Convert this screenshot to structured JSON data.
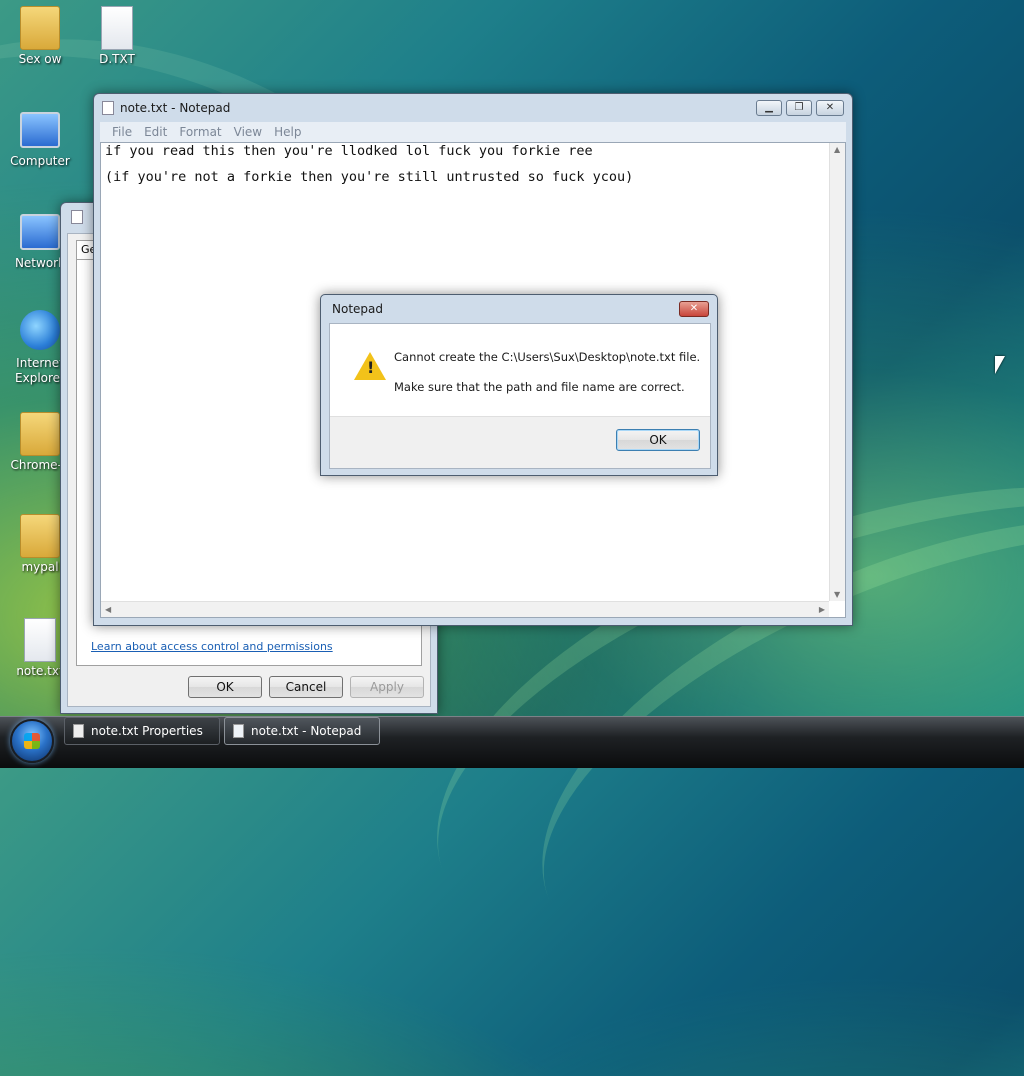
{
  "desktop": {
    "icons": [
      {
        "label": "Sex ow",
        "icon": "folder-icon"
      },
      {
        "label": "D.TXT",
        "icon": "text-file-icon"
      },
      {
        "label": "Computer",
        "icon": "computer-icon"
      },
      {
        "label": "Network",
        "icon": "network-icon"
      },
      {
        "label": "Internet Explorer",
        "icon": "internet-explorer-icon"
      },
      {
        "label": "Chrome-b",
        "icon": "folder-icon"
      },
      {
        "label": "mypal",
        "icon": "folder-icon"
      },
      {
        "label": "note.txt",
        "icon": "text-file-icon"
      }
    ]
  },
  "properties_window": {
    "title": "note.txt Properties",
    "tab_fragment": "Ge",
    "link": "Learn about access control and permissions",
    "ok_label": "OK",
    "cancel_label": "Cancel",
    "apply_label": "Apply"
  },
  "notepad": {
    "title": "note.txt - Notepad",
    "menu": [
      "File",
      "Edit",
      "Format",
      "View",
      "Help"
    ],
    "lines": [
      "if you read this then you're llodked lol fuck you forkie ree",
      "(if you're not a forkie then you're still untrusted so fuck ycou)"
    ]
  },
  "error_dialog": {
    "title": "Notepad",
    "message": "Cannot create the C:\\Users\\Sux\\Desktop\\note.txt file.",
    "detail": "Make sure that the path and file name are correct.",
    "ok_label": "OK",
    "icon": "warning-icon"
  },
  "taskbar": {
    "items": [
      {
        "label": "note.txt Properties",
        "active": false
      },
      {
        "label": "note.txt - Notepad",
        "active": true
      }
    ]
  },
  "colors": {
    "dialog_close": "#c8453a",
    "link": "#1a5fb4"
  }
}
